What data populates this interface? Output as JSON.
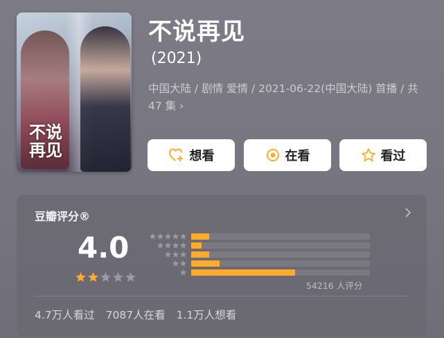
{
  "poster": {
    "title_text": "不说\n再见"
  },
  "title": "不说再见",
  "year": "(2021)",
  "meta": "中国大陆 / 剧情 爱情 / 2021-06-22(中国大陆) 首播 / 共 47 集 ›",
  "actions": [
    {
      "label": "想看",
      "icon": "heart-plus-icon"
    },
    {
      "label": "在看",
      "icon": "target-icon"
    },
    {
      "label": "看过",
      "icon": "star-outline-icon"
    }
  ],
  "rating": {
    "label": "豆瓣评分®",
    "score": "4.0",
    "stars_filled": 2,
    "stars_total": 5,
    "distribution": [
      {
        "stars": 5,
        "fraction": 0.1
      },
      {
        "stars": 4,
        "fraction": 0.06
      },
      {
        "stars": 3,
        "fraction": 0.1
      },
      {
        "stars": 2,
        "fraction": 0.16
      },
      {
        "stars": 1,
        "fraction": 0.58
      }
    ],
    "count_text": "54216 人评分"
  },
  "stats": {
    "watched": "4.7万人看过",
    "watching": "7087人在看",
    "want": "1.1万人想看"
  },
  "colors": {
    "accent": "#ffac2d",
    "star_empty": "#9a99a3"
  }
}
